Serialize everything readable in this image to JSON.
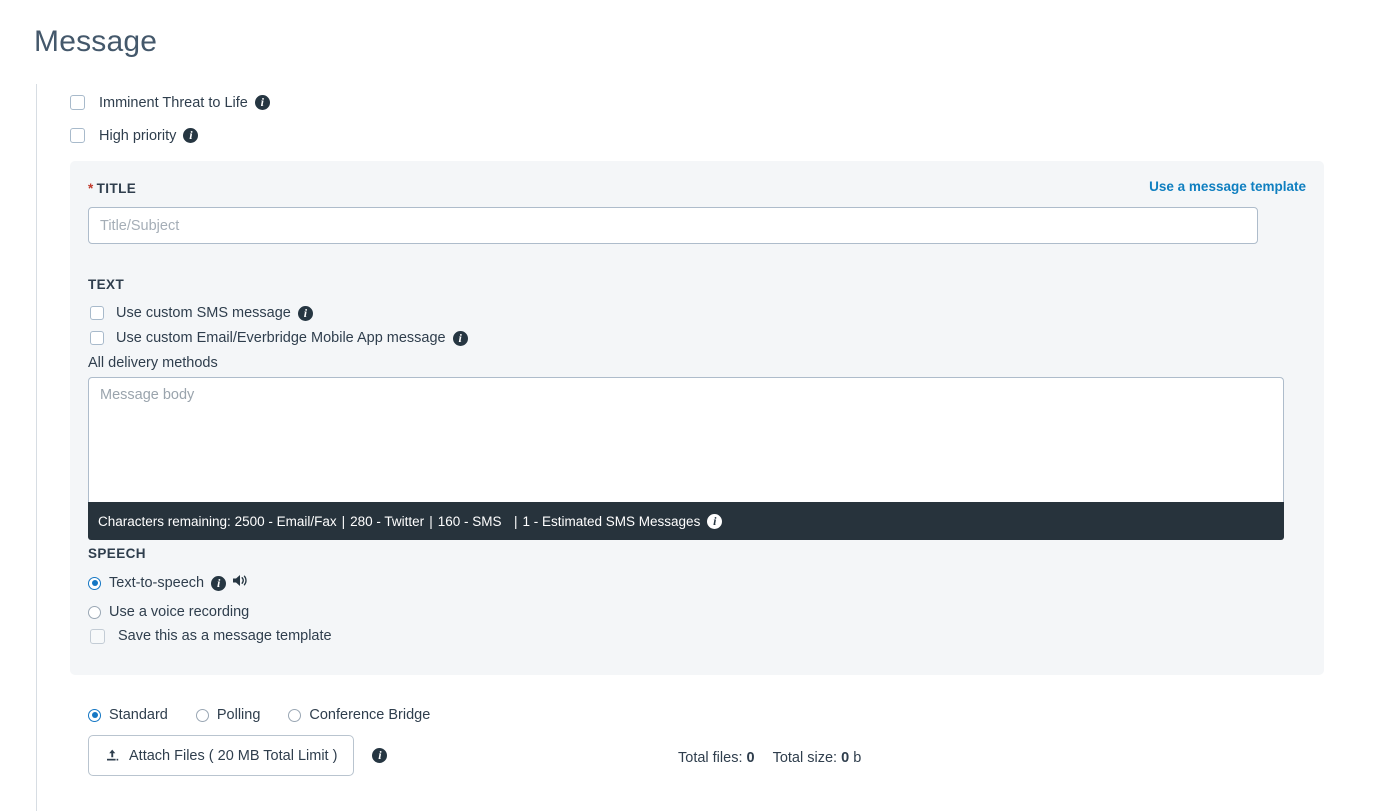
{
  "page": {
    "title": "Message"
  },
  "top_options": [
    {
      "label": "Imminent Threat to Life",
      "icon": "info-icon",
      "checked": false
    },
    {
      "label": "High priority",
      "icon": "info-icon",
      "checked": false
    }
  ],
  "title_section": {
    "required_mark": "*",
    "label": "TITLE",
    "template_link": "Use a message template",
    "input_placeholder": "Title/Subject",
    "input_value": ""
  },
  "text_section": {
    "label": "TEXT",
    "options": [
      {
        "label": "Use custom SMS message",
        "icon": "info-icon",
        "checked": false
      },
      {
        "label": "Use custom Email/Everbridge Mobile App message",
        "icon": "info-icon",
        "checked": false
      }
    ],
    "delivery_note": "All delivery methods",
    "body_placeholder": "Message body",
    "body_value": "",
    "counter": {
      "prefix": "Characters remaining:",
      "items": [
        "2500 - Email/Fax",
        "280 - Twitter",
        "160 - SMS",
        "1 - Estimated SMS Messages"
      ],
      "separator": "|",
      "icon": "info-icon"
    }
  },
  "speech_section": {
    "label": "SPEECH",
    "options": [
      {
        "label": "Text-to-speech",
        "selected": true,
        "icons": [
          "info-icon",
          "speaker-icon"
        ]
      },
      {
        "label": "Use a voice recording",
        "selected": false,
        "icons": []
      }
    ],
    "save_template": {
      "label": "Save this as a message template",
      "checked": false
    }
  },
  "message_type": {
    "options": [
      {
        "label": "Standard",
        "selected": true
      },
      {
        "label": "Polling",
        "selected": false
      },
      {
        "label": "Conference Bridge",
        "selected": false
      }
    ]
  },
  "attachments": {
    "button_label": "Attach Files ( 20 MB Total Limit )",
    "button_icon": "upload-icon",
    "info_icon": "info-icon",
    "total_files_label": "Total files:",
    "total_files_value": "0",
    "total_size_label": "Total size:",
    "total_size_value": "0",
    "total_size_unit": "b"
  },
  "colors": {
    "accent_link": "#0f7fc0",
    "radio_selected": "#1577c4",
    "counter_bar_bg": "#27333c",
    "panel_bg": "#f4f6f8",
    "heading": "#44586b",
    "required": "#c0392b"
  }
}
